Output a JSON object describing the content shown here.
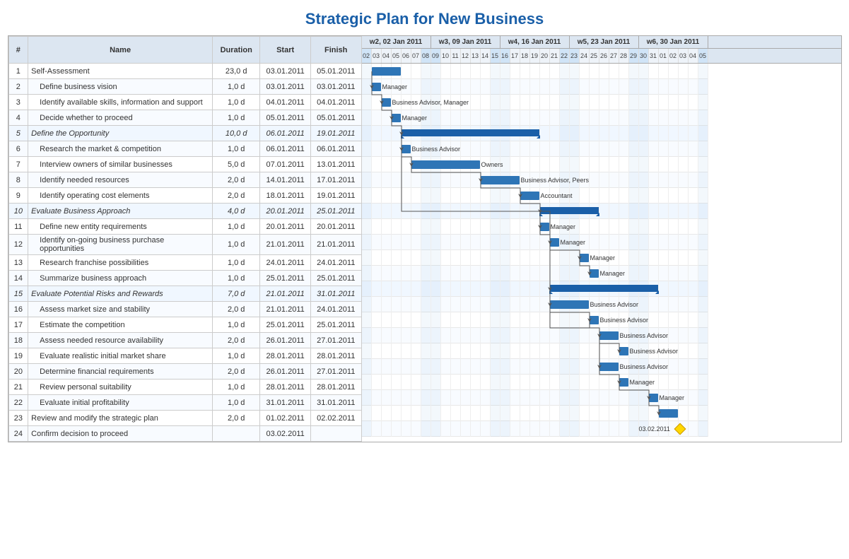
{
  "title": "Strategic Plan for New Business",
  "table": {
    "headers": [
      "#",
      "Name",
      "Duration",
      "Start",
      "Finish"
    ],
    "rows": [
      {
        "num": "1",
        "name": "Self-Assessment",
        "dur": "23,0 d",
        "start": "03.01.2011",
        "finish": "05.01.2011",
        "type": "normal"
      },
      {
        "num": "2",
        "name": "Define business vision",
        "dur": "1,0 d",
        "start": "03.01.2011",
        "finish": "03.01.2011",
        "type": "alt",
        "indent": true
      },
      {
        "num": "3",
        "name": "Identify available skills, information and support",
        "dur": "1,0 d",
        "start": "04.01.2011",
        "finish": "04.01.2011",
        "type": "normal",
        "indent": true
      },
      {
        "num": "4",
        "name": "Decide whether to proceed",
        "dur": "1,0 d",
        "start": "05.01.2011",
        "finish": "05.01.2011",
        "type": "alt",
        "indent": true
      },
      {
        "num": "5",
        "name": "Define the Opportunity",
        "dur": "10,0 d",
        "start": "06.01.2011",
        "finish": "19.01.2011",
        "type": "category"
      },
      {
        "num": "6",
        "name": "Research the market & competition",
        "dur": "1,0 d",
        "start": "06.01.2011",
        "finish": "06.01.2011",
        "type": "normal",
        "indent": true
      },
      {
        "num": "7",
        "name": "Interview owners of similar businesses",
        "dur": "5,0 d",
        "start": "07.01.2011",
        "finish": "13.01.2011",
        "type": "alt",
        "indent": true
      },
      {
        "num": "8",
        "name": "Identify needed resources",
        "dur": "2,0 d",
        "start": "14.01.2011",
        "finish": "17.01.2011",
        "type": "normal",
        "indent": true
      },
      {
        "num": "9",
        "name": "Identify operating cost elements",
        "dur": "2,0 d",
        "start": "18.01.2011",
        "finish": "19.01.2011",
        "type": "alt",
        "indent": true
      },
      {
        "num": "10",
        "name": "Evaluate Business Approach",
        "dur": "4,0 d",
        "start": "20.01.2011",
        "finish": "25.01.2011",
        "type": "category"
      },
      {
        "num": "11",
        "name": "Define new entity requirements",
        "dur": "1,0 d",
        "start": "20.01.2011",
        "finish": "20.01.2011",
        "type": "normal",
        "indent": true
      },
      {
        "num": "12",
        "name": "Identify on-going business purchase opportunities",
        "dur": "1,0 d",
        "start": "21.01.2011",
        "finish": "21.01.2011",
        "type": "alt",
        "indent": true
      },
      {
        "num": "13",
        "name": "Research franchise possibilities",
        "dur": "1,0 d",
        "start": "24.01.2011",
        "finish": "24.01.2011",
        "type": "normal",
        "indent": true
      },
      {
        "num": "14",
        "name": "Summarize business approach",
        "dur": "1,0 d",
        "start": "25.01.2011",
        "finish": "25.01.2011",
        "type": "alt",
        "indent": true
      },
      {
        "num": "15",
        "name": "Evaluate Potential Risks and Rewards",
        "dur": "7,0 d",
        "start": "21.01.2011",
        "finish": "31.01.2011",
        "type": "category"
      },
      {
        "num": "16",
        "name": "Assess market size and stability",
        "dur": "2,0 d",
        "start": "21.01.2011",
        "finish": "24.01.2011",
        "type": "normal",
        "indent": true
      },
      {
        "num": "17",
        "name": "Estimate the competition",
        "dur": "1,0 d",
        "start": "25.01.2011",
        "finish": "25.01.2011",
        "type": "alt",
        "indent": true
      },
      {
        "num": "18",
        "name": "Assess needed resource availability",
        "dur": "2,0 d",
        "start": "26.01.2011",
        "finish": "27.01.2011",
        "type": "normal",
        "indent": true
      },
      {
        "num": "19",
        "name": "Evaluate realistic initial market share",
        "dur": "1,0 d",
        "start": "28.01.2011",
        "finish": "28.01.2011",
        "type": "alt",
        "indent": true
      },
      {
        "num": "20",
        "name": "Determine financial requirements",
        "dur": "2,0 d",
        "start": "26.01.2011",
        "finish": "27.01.2011",
        "type": "normal",
        "indent": true
      },
      {
        "num": "21",
        "name": "Review personal suitability",
        "dur": "1,0 d",
        "start": "28.01.2011",
        "finish": "28.01.2011",
        "type": "alt",
        "indent": true
      },
      {
        "num": "22",
        "name": "Evaluate initial profitability",
        "dur": "1,0 d",
        "start": "31.01.2011",
        "finish": "31.01.2011",
        "type": "normal",
        "indent": true
      },
      {
        "num": "23",
        "name": "Review and modify the strategic plan",
        "dur": "2,0 d",
        "start": "01.02.2011",
        "finish": "02.02.2011",
        "type": "alt"
      },
      {
        "num": "24",
        "name": "Confirm decision to proceed",
        "dur": "",
        "start": "03.02.2011",
        "finish": "",
        "type": "normal"
      }
    ]
  },
  "weeks": [
    {
      "label": "w2, 02 Jan 2011",
      "days": [
        "02",
        "03",
        "04",
        "05",
        "06",
        "07",
        "08"
      ]
    },
    {
      "label": "w3, 09 Jan 2011",
      "days": [
        "09",
        "10",
        "11",
        "12",
        "13",
        "14",
        "15"
      ]
    },
    {
      "label": "w4, 16 Jan 2011",
      "days": [
        "16",
        "17",
        "18",
        "19",
        "20",
        "21",
        "22"
      ]
    },
    {
      "label": "w5, 23 Jan 2011",
      "days": [
        "23",
        "24",
        "25",
        "26",
        "27",
        "28",
        "29"
      ]
    },
    {
      "label": "w6, 30 Jan 2011",
      "days": [
        "30",
        "31",
        "01",
        "02",
        "03",
        "04",
        "05"
      ]
    }
  ]
}
